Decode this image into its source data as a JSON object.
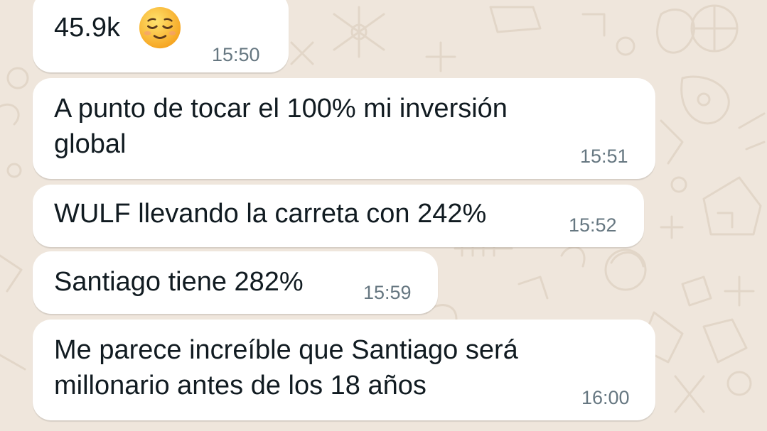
{
  "messages": [
    {
      "text": "45.9k",
      "emoji": "relieved-face-emoji",
      "time": "15:50"
    },
    {
      "lines": [
        "A punto de tocar el 100% mi inversión",
        "global"
      ],
      "time": "15:51"
    },
    {
      "text": "WULF llevando la carreta con 242%",
      "time": "15:52"
    },
    {
      "text": "Santiago tiene 282%",
      "time": "15:59"
    },
    {
      "lines": [
        "Me parece increíble que Santiago será",
        "millonario antes de los 18 años"
      ],
      "time": "16:00"
    }
  ],
  "colors": {
    "background": "#efe6dc",
    "bubble": "#ffffff",
    "text": "#111b21",
    "timestamp": "#667781",
    "doodle": "#e2d6c8"
  }
}
